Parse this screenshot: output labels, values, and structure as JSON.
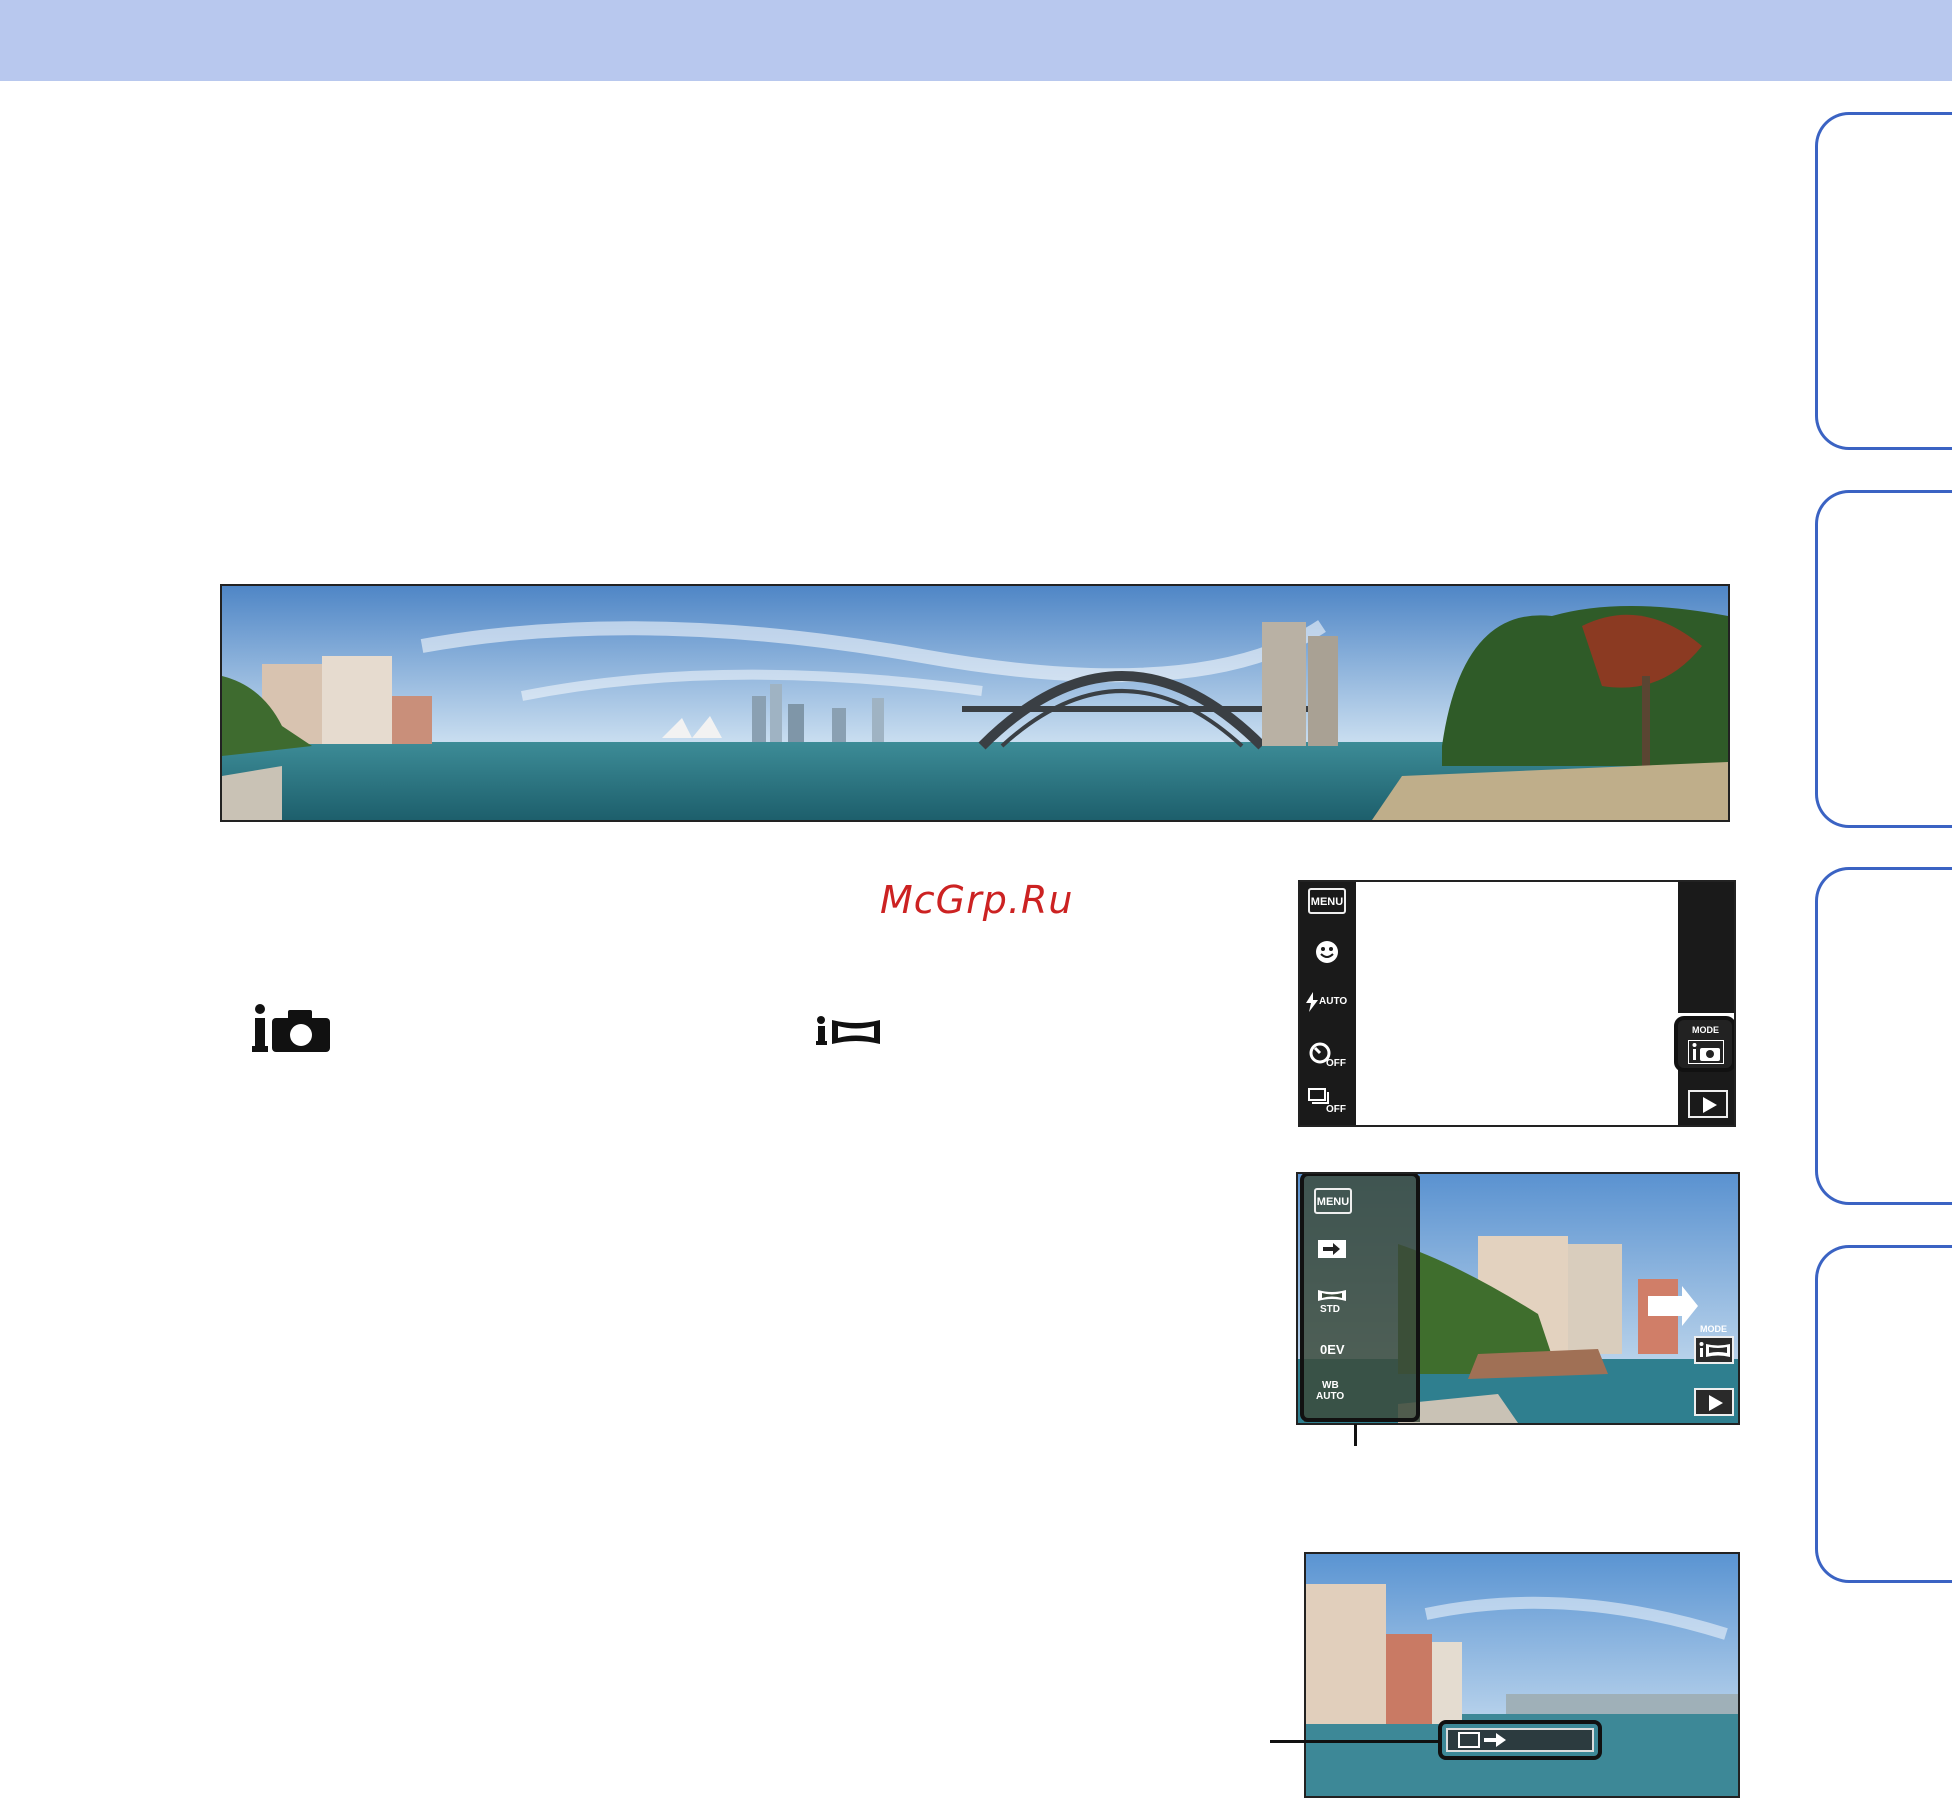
{
  "watermark": "McGrp.Ru",
  "screen1": {
    "menu_label": "MENU",
    "flash_label": "AUTO",
    "timer_label": "OFF",
    "burst_label": "OFF",
    "mode_label": "MODE"
  },
  "screen2": {
    "menu_label": "MENU",
    "std_label": "STD",
    "ev_label": "0EV",
    "wb_label": "WB",
    "wb_sub": "AUTO",
    "mode_label": "MODE"
  }
}
